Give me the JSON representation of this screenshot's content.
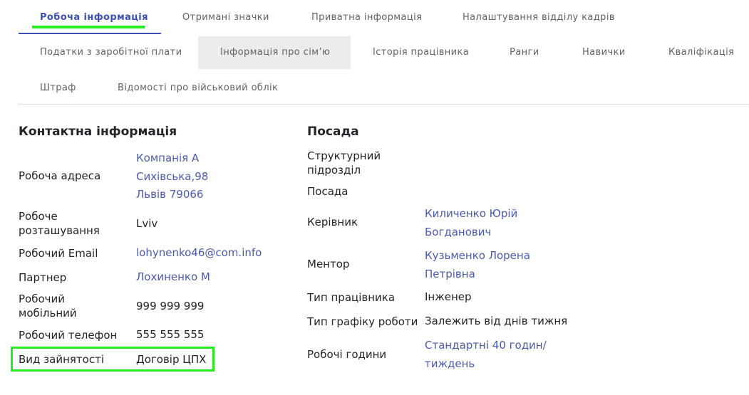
{
  "tabs_row1": [
    "Робоча інформація",
    "Отримані значки",
    "Приватна інформація",
    "Налаштування відділу кадрів"
  ],
  "tabs_row2": [
    "Податки з заробітної плати",
    "Інформація про сім’ю",
    "Історія працівника",
    "Ранги",
    "Навички",
    "Кваліфікація"
  ],
  "tabs_row3": [
    "Штраф",
    "Відомості про військовий облік"
  ],
  "contact": {
    "title": "Контактна інформація",
    "work_address_label": "Робоча адреса",
    "work_address_lines": [
      "Компанія A",
      "Сихівська,98",
      "Львів 79066"
    ],
    "work_location_label": "Робоче розташування",
    "work_location_value": "Lviv",
    "work_email_label": "Робочий Email",
    "work_email_value": "lohynenko46@com.info",
    "partner_label": "Партнер",
    "partner_value": "Лохиненко М",
    "work_mobile_label": "Робочий мобільний",
    "work_mobile_value": "999 999 999",
    "work_phone_label": "Робочий телефон",
    "work_phone_value": "555 555 555",
    "employment_type_label": "Вид зайнятості",
    "employment_type_value": "Договір ЦПХ"
  },
  "position": {
    "title": "Посада",
    "department_label": "Структурний підрозділ",
    "job_label": "Посада",
    "manager_label": "Керівник",
    "manager_lines": [
      "Киличенко Юрій",
      "Богданович"
    ],
    "mentor_label": "Ментор",
    "mentor_lines": [
      "Кузьменко Лорена",
      "Петрівна"
    ],
    "employee_type_label": "Тип працівника",
    "employee_type_value": "Інженер",
    "schedule_type_label": "Тип графіку роботи",
    "schedule_type_value": "Залежить від днів тижня",
    "working_hours_label": "Робочі години",
    "working_hours_lines": [
      "Стандартні 40 годин/",
      "тиждень"
    ]
  },
  "colors": {
    "accent": "#3f51b5",
    "link": "#4b5bab",
    "highlight": "#22ee22"
  }
}
